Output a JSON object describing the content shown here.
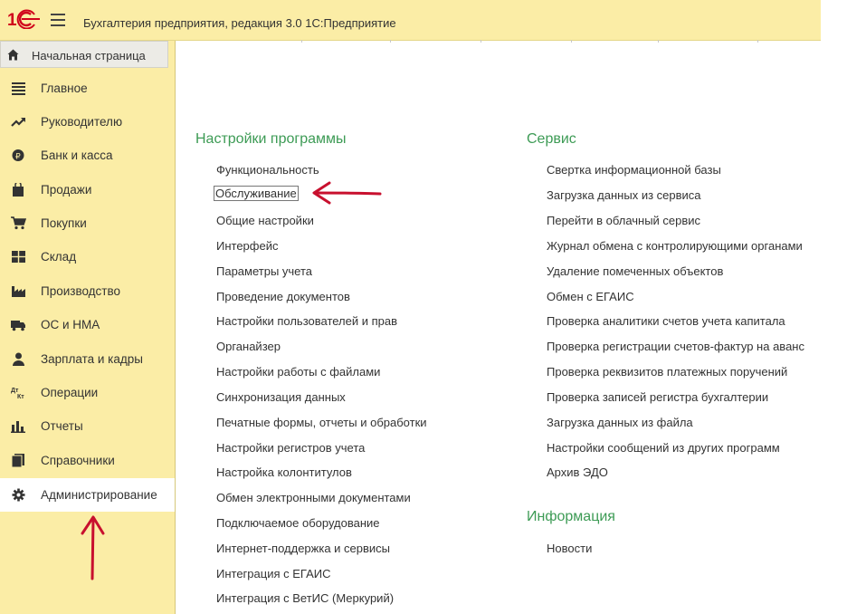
{
  "header": {
    "logo_text": "1С",
    "title": "Бухгалтерия предприятия, редакция 3.0 1С:Предприятие"
  },
  "sidebar": {
    "home_label": "Начальная страница",
    "items": [
      {
        "label": "Главное",
        "icon": "menu-lines-icon"
      },
      {
        "label": "Руководителю",
        "icon": "trend-up-icon"
      },
      {
        "label": "Банк и касса",
        "icon": "ruble-coin-icon"
      },
      {
        "label": "Продажи",
        "icon": "shopping-bag-icon"
      },
      {
        "label": "Покупки",
        "icon": "cart-icon"
      },
      {
        "label": "Склад",
        "icon": "warehouse-icon"
      },
      {
        "label": "Производство",
        "icon": "factory-icon"
      },
      {
        "label": "ОС и НМА",
        "icon": "truck-icon"
      },
      {
        "label": "Зарплата и кадры",
        "icon": "person-icon"
      },
      {
        "label": "Операции",
        "icon": "debit-credit-icon"
      },
      {
        "label": "Отчеты",
        "icon": "bar-chart-icon"
      },
      {
        "label": "Справочники",
        "icon": "book-icon"
      },
      {
        "label": "Администрирование",
        "icon": "gear-icon",
        "active": true
      }
    ]
  },
  "settings": {
    "title": "Настройки программы",
    "links": [
      "Функциональность",
      "Обслуживание",
      "Общие настройки",
      "Интерфейс",
      "Параметры учета",
      "Проведение документов",
      "Настройки пользователей и прав",
      "Органайзер",
      "Настройки работы с файлами",
      "Синхронизация данных",
      "Печатные формы, отчеты и обработки",
      "Настройки регистров учета",
      "Настройка колонтитулов",
      "Обмен электронными документами",
      "Подключаемое оборудование",
      "Интернет-поддержка и сервисы",
      "Интеграция с ЕГАИС",
      "Интеграция с ВетИС (Меркурий)"
    ]
  },
  "service": {
    "title": "Сервис",
    "links": [
      "Свертка информационной базы",
      "Загрузка данных из сервиса",
      "Перейти в облачный сервис",
      "Журнал обмена с контролирующими органами",
      "Удаление помеченных объектов",
      "Обмен с ЕГАИС",
      "Проверка аналитики счетов учета капитала",
      "Проверка регистрации счетов-фактур на аванс",
      "Проверка реквизитов платежных поручений",
      "Проверка записей регистра бухгалтерии",
      "Загрузка данных из файла",
      "Настройки сообщений из других программ",
      "Архив ЭДО"
    ]
  },
  "info": {
    "title": "Информация",
    "links": [
      "Новости"
    ]
  },
  "colors": {
    "accent_yellow": "#fbeda6",
    "group_green": "#3d9b55",
    "annotation_red": "#c8102e",
    "logo_red": "#d0021b"
  }
}
